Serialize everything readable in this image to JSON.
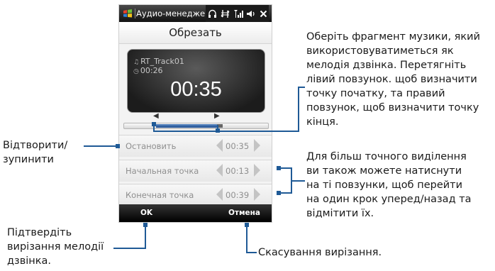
{
  "titlebar": {
    "title": "Аудио-менедже",
    "icons": [
      "headphones-icon",
      "connectivity-icon",
      "signal-icon",
      "volume-icon",
      "close-icon"
    ]
  },
  "heading": "Обрезать",
  "player": {
    "track_name": "RT_Track01",
    "duration": "00:26",
    "current_time": "00:35"
  },
  "rows": [
    {
      "label": "Остановить",
      "value": "00:35"
    },
    {
      "label": "Начальная точка",
      "value": "00:13"
    },
    {
      "label": "Конечная точка",
      "value": "00:39"
    }
  ],
  "softkeys": {
    "left": "OK",
    "right": "Отмена"
  },
  "callouts": {
    "select_fragment": [
      "Оберіть фрагмент музики, який",
      "використовуватиметься як",
      "мелодія дзвінка. Перетягніть",
      "лівий повзунок. щоб визначити",
      "точку початку, та правий",
      "повзунок, щоб визначити точку",
      "кінця."
    ],
    "play_stop": [
      "Відтворити/",
      "зупинити"
    ],
    "precise": [
      "Для більш точного виділення",
      "ви також можете натиснути",
      "на ті повзунки, щоб перейти",
      "на один крок уперед/назад та",
      "відмітити їх."
    ],
    "confirm": [
      "Підтвердіть",
      "вирізання мелодії",
      "дзвінка."
    ],
    "cancel": "Скасування вирізання."
  },
  "colors": {
    "callout_line": "#1f5a96",
    "selection": "#1c4c90"
  }
}
